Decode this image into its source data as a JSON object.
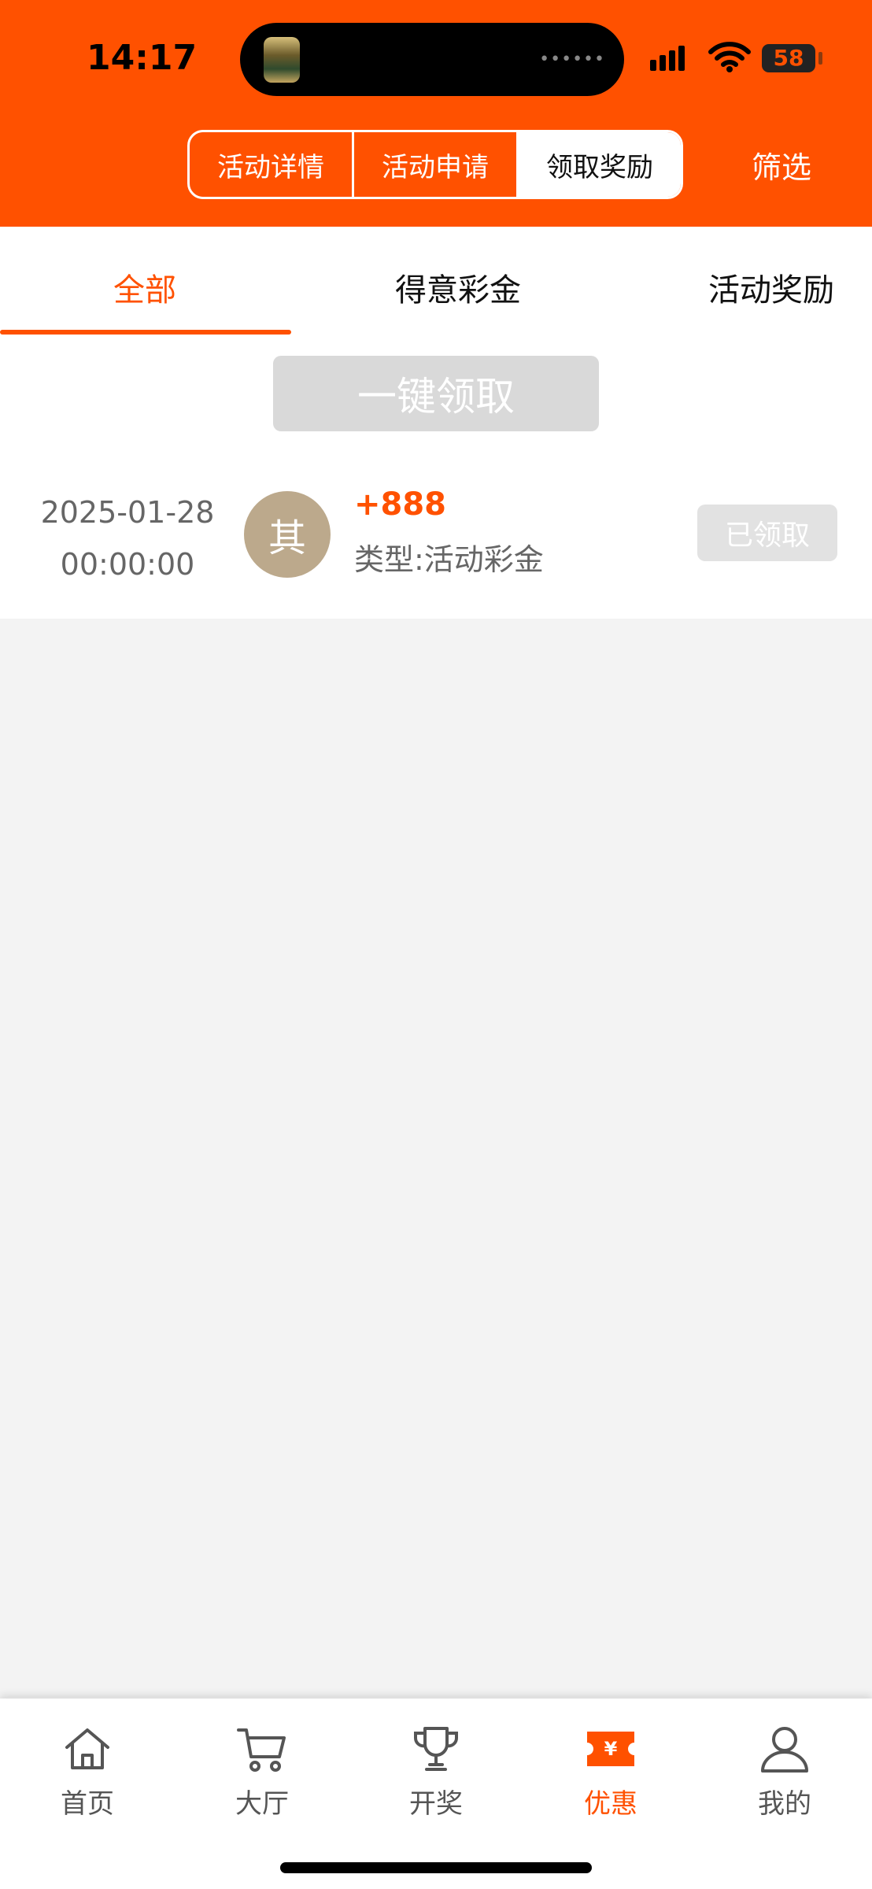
{
  "status_bar": {
    "time": "14:17",
    "battery": "58"
  },
  "header": {
    "segments": [
      "活动详情",
      "活动申请",
      "领取奖励"
    ],
    "active_segment": "领取奖励",
    "filter_label": "筛选",
    "background_color": "#ff5100"
  },
  "tabs": {
    "items": [
      "全部",
      "得意彩金",
      "活动奖励"
    ],
    "active": "全部"
  },
  "claim_all_label": "一键领取",
  "records": [
    {
      "date": "2025-01-28",
      "time": "00:00:00",
      "avatar_char": "其",
      "amount": "+888",
      "type": "类型:活动彩金",
      "status": "已领取"
    }
  ],
  "bottom_nav": {
    "items": [
      {
        "label": "首页",
        "icon": "home-icon"
      },
      {
        "label": "大厅",
        "icon": "cart-icon"
      },
      {
        "label": "开奖",
        "icon": "trophy-icon"
      },
      {
        "label": "优惠",
        "icon": "coupon-icon"
      },
      {
        "label": "我的",
        "icon": "user-icon"
      }
    ],
    "active": "优惠"
  }
}
